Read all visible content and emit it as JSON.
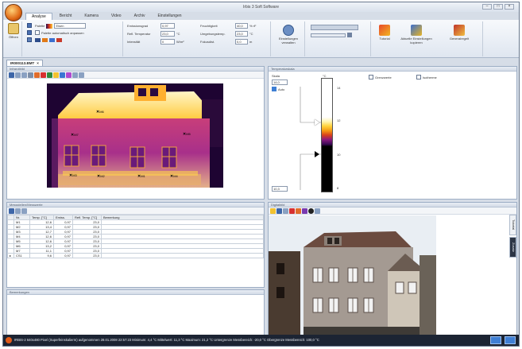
{
  "window": {
    "title": "Irbis 3 Soft Software",
    "controls": [
      "–",
      "□",
      "×"
    ]
  },
  "ribbon": {
    "tabs": [
      "Analyse",
      "Bericht",
      "Kamera",
      "Video",
      "Archiv",
      "Einstellungen"
    ],
    "open_label": "Öffnen",
    "palette_label": "Palette",
    "palette_value": "Eisen",
    "palette_fit_label": "Palette automatisch anpassen",
    "emiss_label": "Emissionsgrad",
    "emiss_value": "0,97",
    "refl_label": "Refl. Temperatur",
    "refl_value": "23,0",
    "refl_unit": "°C",
    "intensity_label": "Intensität",
    "intensity_value": "0",
    "intensity_unit": "W/m²",
    "humidity_label": "Feuchtigkeit",
    "humidity_value": "40,0",
    "humidity_unit": "% rF",
    "ambient_label": "Umgebungstemp.",
    "ambient_value": "23,0",
    "ambient_unit": "°C",
    "distance_label": "Fokusdist.",
    "distance_value": "0,0",
    "distance_unit": "m",
    "settings_label": "Einstellungen verwalten",
    "tutorial_label": "Tutorial",
    "current_settings_label": "Aktuelle Einstellungen kopieren",
    "general_label": "Generalregelt"
  },
  "document": {
    "tab_label": "IR000113.BMT",
    "close": "×"
  },
  "thermal_pane": {
    "header": "Infrarotbild",
    "markers": [
      {
        "label": "M6",
        "color": "#000"
      },
      {
        "label": "M7",
        "color": "#000"
      },
      {
        "label": "M5",
        "color": "#000"
      },
      {
        "label": "M3",
        "color": "#000"
      },
      {
        "label": "M2",
        "color": "#000"
      },
      {
        "label": "M1",
        "color": "#000"
      },
      {
        "label": "M4",
        "color": "#000"
      }
    ]
  },
  "scale_pane": {
    "header": "Temperaturskala",
    "scale_label": "Skala",
    "unit": "°C",
    "max_value": "14,0",
    "min_value": "10,3",
    "auto_label": "Auto",
    "ticks": [
      "14",
      "12",
      "10",
      "8"
    ],
    "limit_label": "Grenzwerte",
    "isotherm_label": "Isotherme"
  },
  "measurements": {
    "header": "Messstellen/Messwerte",
    "columns": [
      "Nr.",
      "Temp. [°C]",
      "Emiss.",
      "Refl. Temp. [°C]",
      "Bemerkung"
    ],
    "rows": [
      [
        "M1",
        "12,6",
        "0,97",
        "23,0",
        ""
      ],
      [
        "M2",
        "13,4",
        "0,97",
        "23,0",
        ""
      ],
      [
        "M3",
        "12,7",
        "0,97",
        "23,0",
        ""
      ],
      [
        "M4",
        "12,6",
        "0,97",
        "23,0",
        ""
      ],
      [
        "M5",
        "12,6",
        "0,97",
        "23,0",
        ""
      ],
      [
        "M6",
        "13,2",
        "0,97",
        "23,0",
        ""
      ],
      [
        "M7",
        "11,1",
        "0,97",
        "23,0",
        ""
      ],
      [
        "CS1",
        "9,6",
        "0,97",
        "23,0",
        ""
      ]
    ]
  },
  "notes_pane": {
    "header": "Bemerkungen"
  },
  "photo_pane": {
    "header": "Digitalbild",
    "side_tabs": [
      "Tutorial",
      "Zusatz"
    ]
  },
  "status": {
    "text": "IRBIS-2 640x480 Pixel (Superfeinskalierm) aufgenommen 28.01.2008 22:57:23 Minimum: 4,4 °C Mittelwert: 11,3 °C Maximum: 21,2 °C Untergrenze Messbereich: -20,0 °C Obergrenze Messbereich: 100,0 °C"
  }
}
